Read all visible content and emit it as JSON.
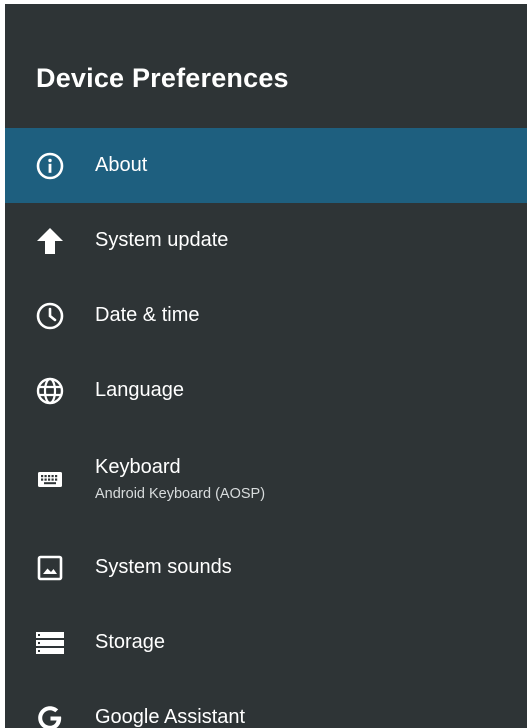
{
  "header": {
    "title": "Device Preferences"
  },
  "menu": {
    "items": [
      {
        "label": "About",
        "icon": "info-icon",
        "selected": true
      },
      {
        "label": "System update",
        "icon": "arrow-up-icon"
      },
      {
        "label": "Date & time",
        "icon": "clock-icon"
      },
      {
        "label": "Language",
        "icon": "globe-icon"
      },
      {
        "label": "Keyboard",
        "sublabel": "Android Keyboard (AOSP)",
        "icon": "keyboard-icon"
      },
      {
        "label": "System sounds",
        "icon": "image-icon"
      },
      {
        "label": "Storage",
        "icon": "storage-icon"
      },
      {
        "label": "Google Assistant",
        "icon": "google-icon"
      }
    ]
  },
  "colors": {
    "background": "#2e3436",
    "selected": "#1e5f7f",
    "text": "#ffffff"
  }
}
